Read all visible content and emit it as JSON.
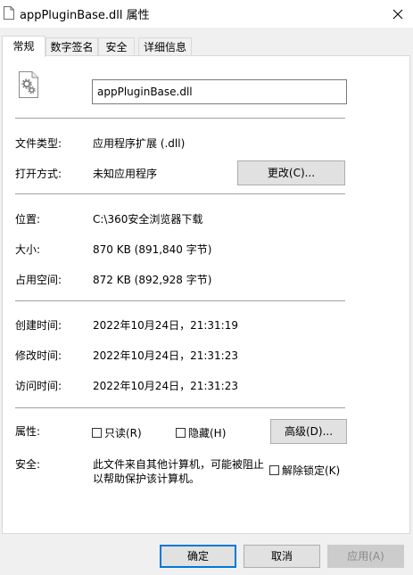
{
  "window": {
    "title": "appPluginBase.dll 属性",
    "close_icon": "close-icon"
  },
  "tabs": [
    {
      "label": "常规",
      "active": true
    },
    {
      "label": "数字签名",
      "active": false
    },
    {
      "label": "安全",
      "active": false
    },
    {
      "label": "详细信息",
      "active": false
    }
  ],
  "general": {
    "file_icon": "dll-gear-file-icon",
    "filename": "appPluginBase.dll",
    "type_label": "文件类型:",
    "type_value": "应用程序扩展 (.dll)",
    "opens_with_label": "打开方式:",
    "opens_with_value": "未知应用程序",
    "change_button": "更改(C)...",
    "location_label": "位置:",
    "location_value": "C:\\360安全浏览器下载",
    "size_label": "大小:",
    "size_value": "870 KB (891,840 字节)",
    "size_on_disk_label": "占用空间:",
    "size_on_disk_value": "872 KB (892,928 字节)",
    "created_label": "创建时间:",
    "created_value": "2022年10月24日，21:31:19",
    "modified_label": "修改时间:",
    "modified_value": "2022年10月24日，21:31:23",
    "accessed_label": "访问时间:",
    "accessed_value": "2022年10月24日，21:31:23",
    "attributes_label": "属性:",
    "readonly_label": "只读(R)",
    "readonly_checked": false,
    "hidden_label": "隐藏(H)",
    "hidden_checked": false,
    "advanced_button": "高级(D)...",
    "security_label": "安全:",
    "security_text_line1": "此文件来自其他计算机，可能被阻止",
    "security_text_line2": "以帮助保护该计算机。",
    "unblock_label": "解除锁定(K)",
    "unblock_checked": false
  },
  "footer": {
    "ok": "确定",
    "cancel": "取消",
    "apply": "应用(A)"
  }
}
